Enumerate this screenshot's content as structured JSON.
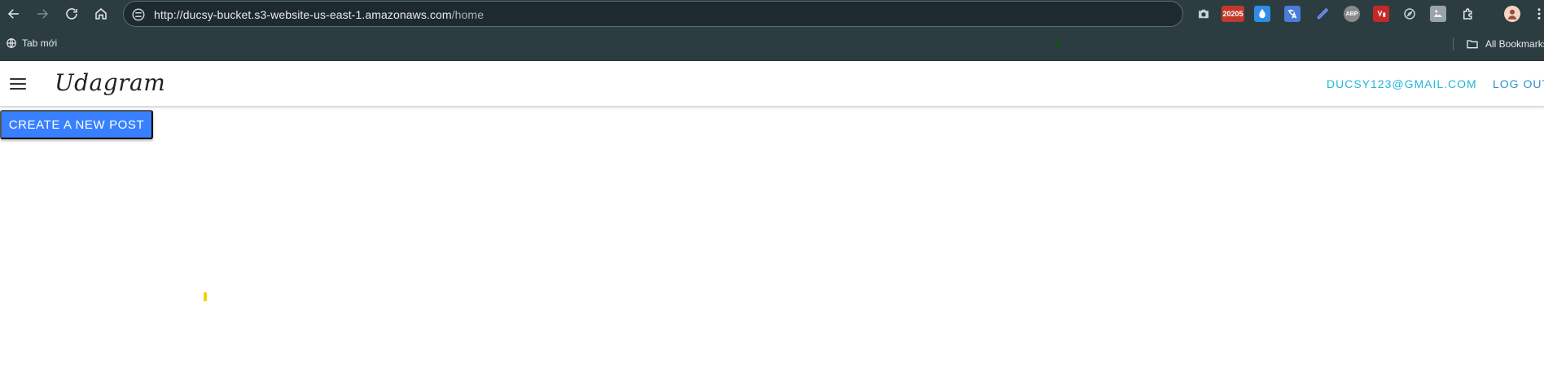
{
  "browser": {
    "url_host": "http://ducsy-bucket.s3-website-us-east-1.amazonaws.com",
    "url_path": "/home",
    "extensions": [
      {
        "icon": "camera-icon",
        "label": ""
      },
      {
        "icon": "badge-extension-icon",
        "label": "20205"
      },
      {
        "icon": "droplet-icon",
        "label": ""
      },
      {
        "icon": "translate-icon",
        "label": ""
      },
      {
        "icon": "eyedropper-icon",
        "label": ""
      },
      {
        "icon": "adblock-icon",
        "label": "ABP"
      },
      {
        "icon": "video-icon",
        "label": ""
      },
      {
        "icon": "compass-icon",
        "label": ""
      },
      {
        "icon": "image-icon",
        "label": ""
      },
      {
        "icon": "puzzle-icon",
        "label": ""
      },
      {
        "icon": "profile-avatar-icon",
        "label": ""
      },
      {
        "icon": "more-vertical-icon",
        "label": ""
      }
    ],
    "bookmarks": {
      "new_tab_label": "Tab mới",
      "all_bookmarks_label": "All Bookmarks"
    }
  },
  "header": {
    "brand": "Udagram",
    "email": "DUCSY123@GMAIL.COM",
    "logout": "LOG OUT"
  },
  "main": {
    "create_post_label": "CREATE A NEW POST"
  },
  "colors": {
    "chrome_bg": "#2b3d40",
    "primary_button": "#3880ff",
    "link_accent": "#21b6d8"
  }
}
